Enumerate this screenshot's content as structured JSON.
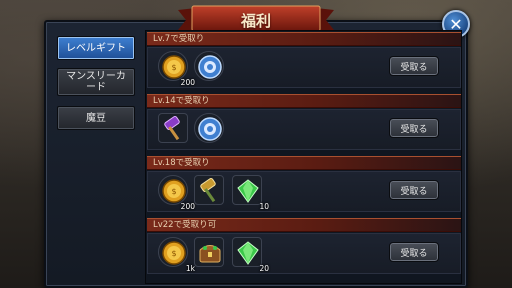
{
  "window": {
    "title": "福利",
    "close_symbol": "✕"
  },
  "sidebar": {
    "items": [
      {
        "label": "レベルギフト",
        "active": true
      },
      {
        "label": "マンスリーカード",
        "active": false
      },
      {
        "label": "魔豆",
        "active": false
      }
    ]
  },
  "rewards": [
    {
      "label": "Lv.7で受取り",
      "button": "受取る",
      "items": [
        {
          "icon": "gold-coin-icon",
          "qty": "200"
        },
        {
          "icon": "blue-orb-icon",
          "qty": ""
        }
      ]
    },
    {
      "label": "Lv.14で受取り",
      "button": "受取る",
      "items": [
        {
          "icon": "purple-hammer-icon",
          "qty": ""
        },
        {
          "icon": "blue-orb-icon",
          "qty": ""
        }
      ]
    },
    {
      "label": "Lv.18で受取り",
      "button": "受取る",
      "items": [
        {
          "icon": "gold-coin-icon",
          "qty": "200"
        },
        {
          "icon": "golden-hammer-icon",
          "qty": ""
        },
        {
          "icon": "green-gem-icon",
          "qty": "10"
        }
      ]
    },
    {
      "label": "Lv22で受取り可",
      "button": "受取る",
      "items": [
        {
          "icon": "gold-coin-icon",
          "qty": "1k"
        },
        {
          "icon": "treasure-chest-icon",
          "qty": ""
        },
        {
          "icon": "green-gem-icon",
          "qty": "20"
        }
      ]
    }
  ],
  "colors": {
    "accent_blue": "#2e6cc0",
    "header_red": "#7a2a1a",
    "panel_dark": "#141a24"
  }
}
